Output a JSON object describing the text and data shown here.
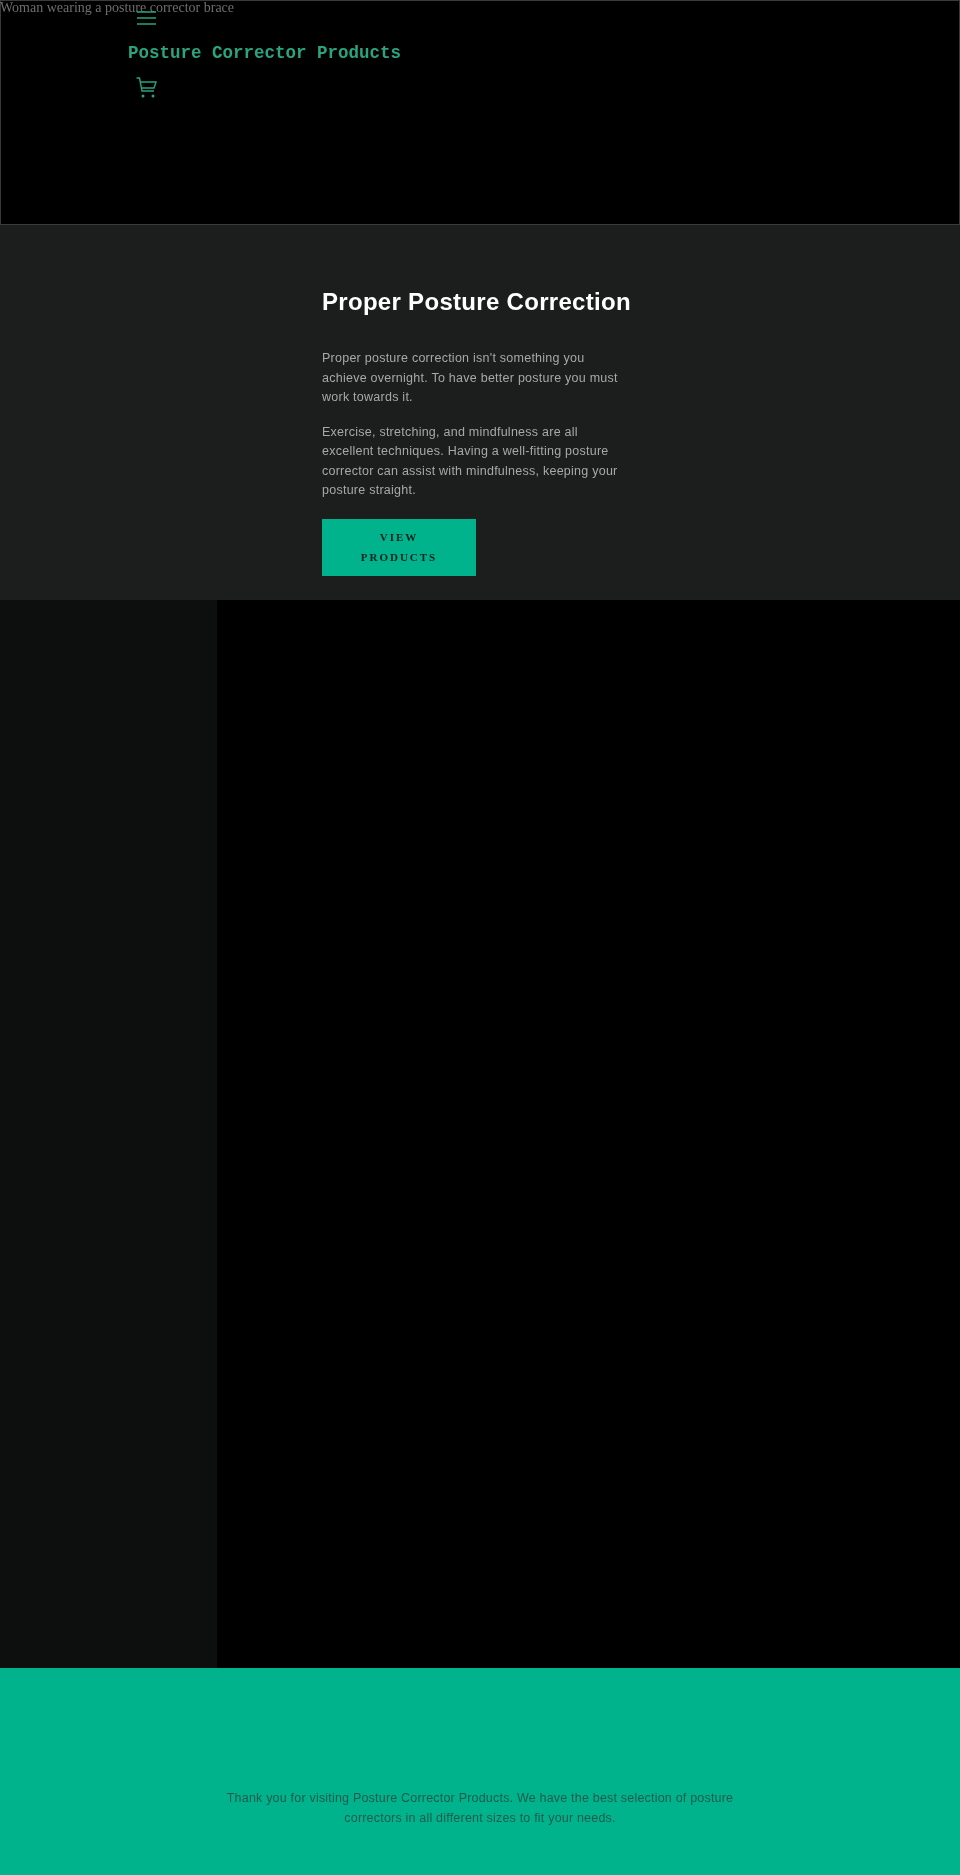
{
  "hero_image": {
    "alt_text": "Woman wearing a posture corrector brace"
  },
  "header": {
    "site_title": "Posture Corrector Products"
  },
  "intro": {
    "heading": "Proper Posture Correction",
    "paragraphs": [
      "Proper posture correction isn't something you achieve overnight. To have better posture you must work towards it.",
      "Exercise, stretching, and mindfulness are all excellent techniques. Having a well-fitting posture corrector can assist with mindfulness, keeping your posture straight."
    ],
    "button": "VIEW PRODUCTS"
  },
  "footer": {
    "text": "Thank you for visiting Posture Corrector Products. We have the best selection of posture correctors in all different sizes to fit your needs."
  }
}
